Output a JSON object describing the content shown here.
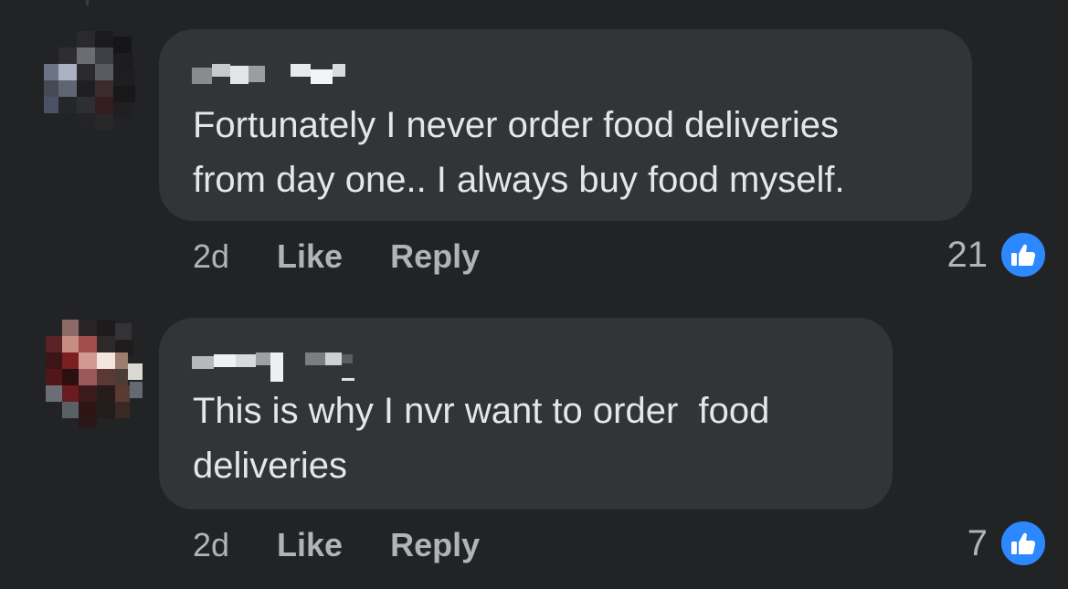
{
  "comments": [
    {
      "author_redacted": true,
      "text": "Fortunately I never order food deliveries\nfrom day one.. I always buy food myself.",
      "time": "2d",
      "like_label": "Like",
      "reply_label": "Reply",
      "like_count": "21"
    },
    {
      "author_redacted": true,
      "text": "This is why I nvr want to order  food\ndeliveries",
      "time": "2d",
      "like_label": "Like",
      "reply_label": "Reply",
      "like_count": "7"
    }
  ],
  "icons": {
    "like_reaction": "thumbs-up-icon"
  },
  "colors": {
    "background": "#222325",
    "bubble": "#333436",
    "text": "#e4e6eb",
    "secondary_text": "#b0b3b8",
    "like_blue": "#2d88ff"
  }
}
